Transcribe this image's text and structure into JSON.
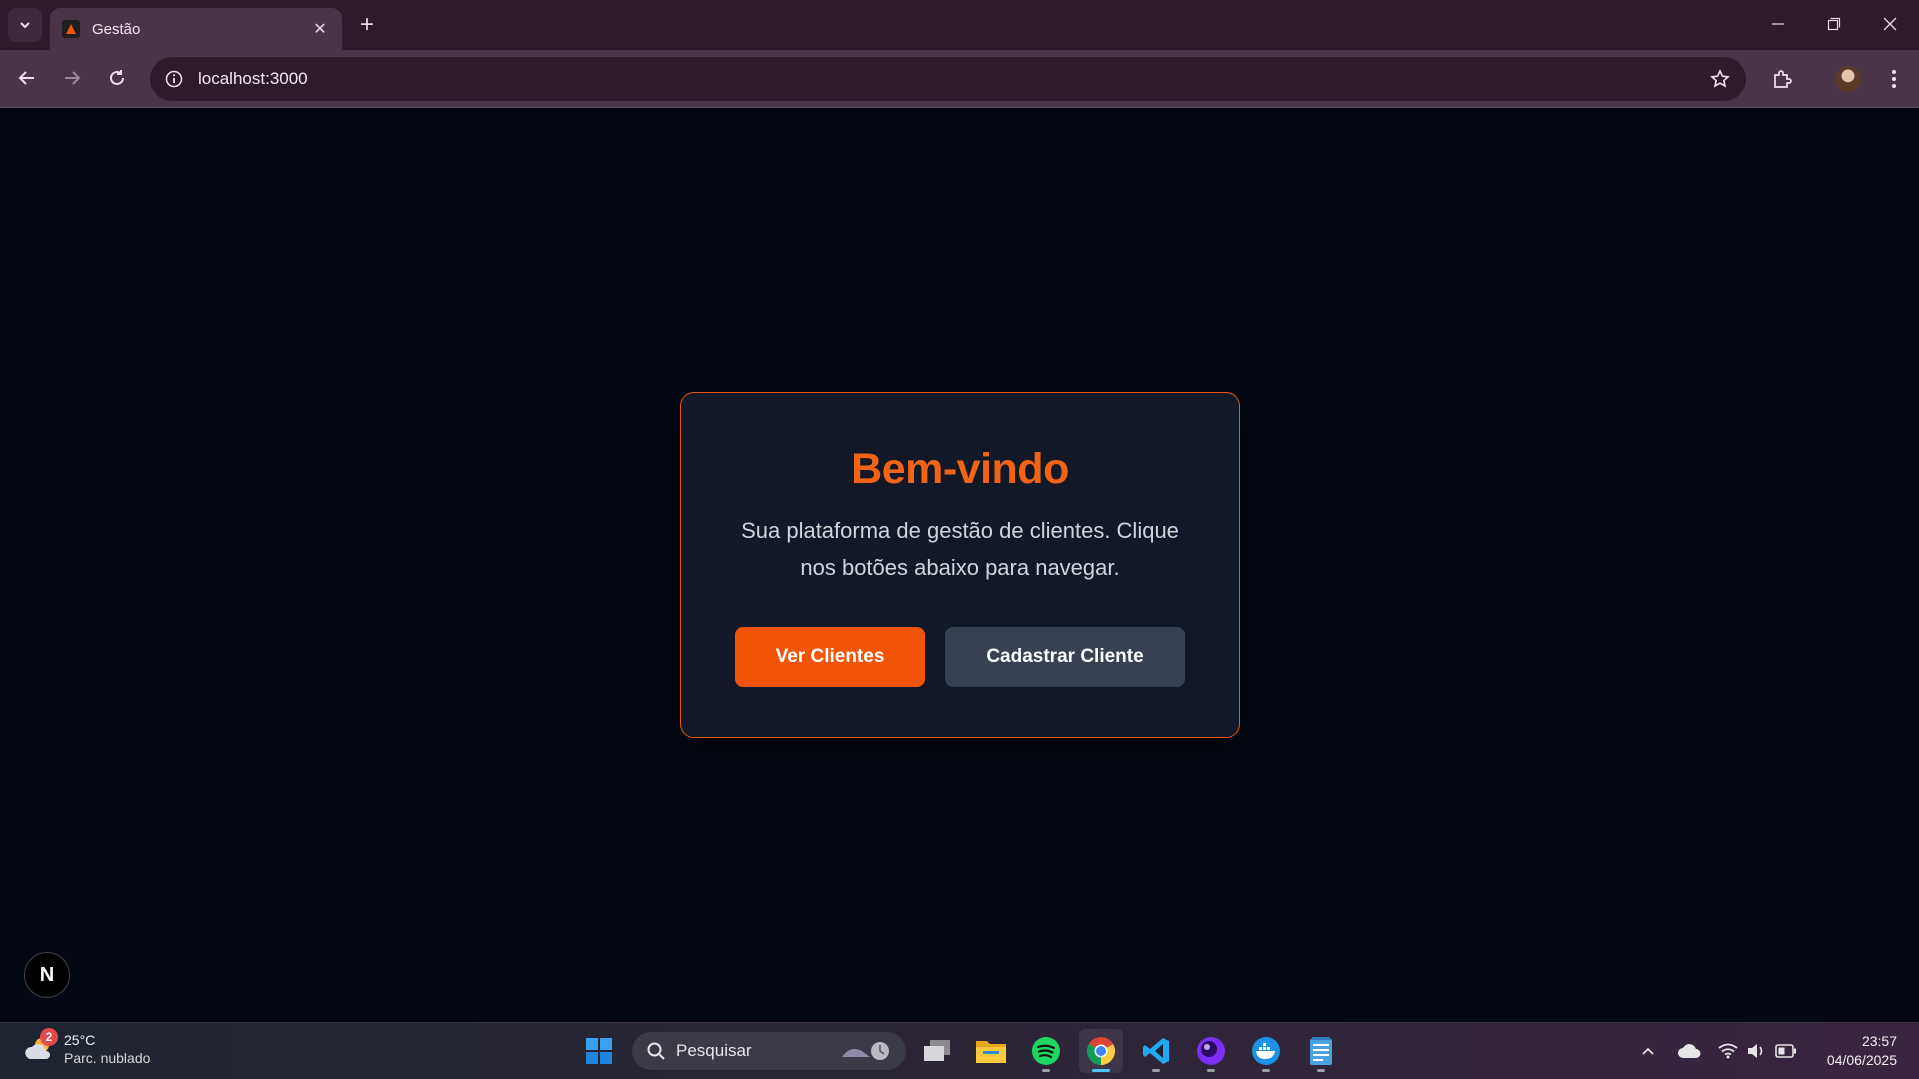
{
  "browser": {
    "tab": {
      "title": "Gestão"
    },
    "url": "localhost:3000"
  },
  "page": {
    "title": "Bem-vindo",
    "description": "Sua plataforma de gestão de clientes. Clique nos botões abaixo para navegar.",
    "buttons": {
      "primary": "Ver Clientes",
      "secondary": "Cadastrar Cliente"
    },
    "colors": {
      "accent": "#f25407",
      "card_bg": "#111827",
      "page_bg": "#030712",
      "secondary_btn": "#374151"
    },
    "dev_badge": "N"
  },
  "taskbar": {
    "weather": {
      "temp": "25°C",
      "desc": "Parc. nublado",
      "badge": "2"
    },
    "search_placeholder": "Pesquisar",
    "clock": {
      "time": "23:57",
      "date": "04/06/2025"
    },
    "apps": [
      "start-icon",
      "task-view-icon",
      "file-explorer-icon",
      "spotify-icon",
      "chrome-icon",
      "vscode-icon",
      "app-purple-icon",
      "docker-icon",
      "notepad-icon"
    ]
  }
}
